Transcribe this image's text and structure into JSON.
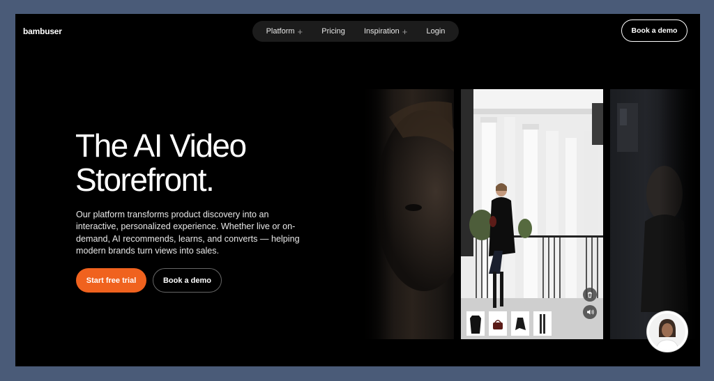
{
  "brand": {
    "logo": "bambuser",
    "accent": "#f0621e"
  },
  "nav": {
    "items": [
      {
        "label": "Platform",
        "plus": "+"
      },
      {
        "label": "Pricing",
        "plus": ""
      },
      {
        "label": "Inspiration",
        "plus": "+"
      },
      {
        "label": "Login",
        "plus": ""
      }
    ]
  },
  "header": {
    "demo_label": "Book a demo"
  },
  "hero": {
    "title_line1": "The AI Video",
    "title_line2": "Storefront.",
    "description": "Our platform transforms product discovery into an interactive, personalized experience. Whether live or on-demand, AI recommends, learns, and converts — helping modern brands turn views into sales.",
    "primary_button": "Start free trial",
    "secondary_button": "Book a demo"
  },
  "video": {
    "controls": [
      "trash-icon",
      "volume-icon"
    ],
    "products": [
      "top-icon",
      "handbag-icon",
      "skirt-icon",
      "tights-icon"
    ]
  }
}
